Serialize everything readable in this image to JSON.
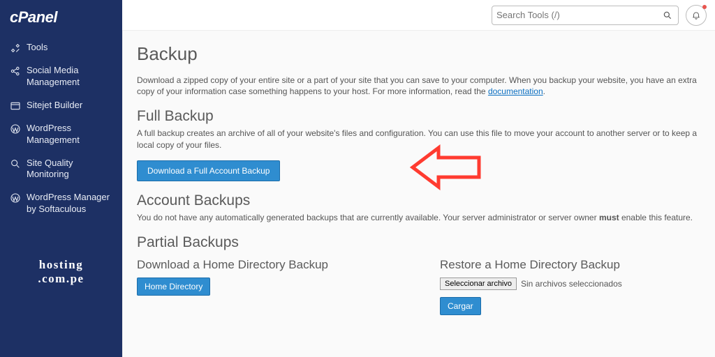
{
  "logo": "cPanel",
  "sidebar": {
    "items": [
      {
        "label": "Tools"
      },
      {
        "label": "Social Media Management"
      },
      {
        "label": "Sitejet Builder"
      },
      {
        "label": "WordPress Management"
      },
      {
        "label": "Site Quality Monitoring"
      },
      {
        "label": "WordPress Manager by Softaculous"
      }
    ],
    "brand_line1": "hosting",
    "brand_line2": ".com.pe"
  },
  "topbar": {
    "search_placeholder": "Search Tools (/)"
  },
  "page": {
    "title": "Backup",
    "intro_a": "Download a zipped copy of your entire site or a part of your site that you can save to your computer. When you backup your website, you have an extra copy of your information case something happens to your host. For more information, read the ",
    "intro_link": "documentation",
    "intro_b": ".",
    "full_title": "Full Backup",
    "full_desc": "A full backup creates an archive of all of your website's files and configuration. You can use this file to move your account to another server or to keep a local copy of your files.",
    "full_button": "Download a Full Account Backup",
    "account_title": "Account Backups",
    "account_desc_a": "You do not have any automatically generated backups that are currently available. Your server administrator or server owner ",
    "account_desc_bold": "must",
    "account_desc_b": " enable this feature.",
    "partial_title": "Partial Backups",
    "download_home_title": "Download a Home Directory Backup",
    "home_dir_button": "Home Directory",
    "restore_home_title": "Restore a Home Directory Backup",
    "file_select": "Seleccionar archivo",
    "file_none": "Sin archivos seleccionados",
    "upload_button": "Cargar"
  }
}
